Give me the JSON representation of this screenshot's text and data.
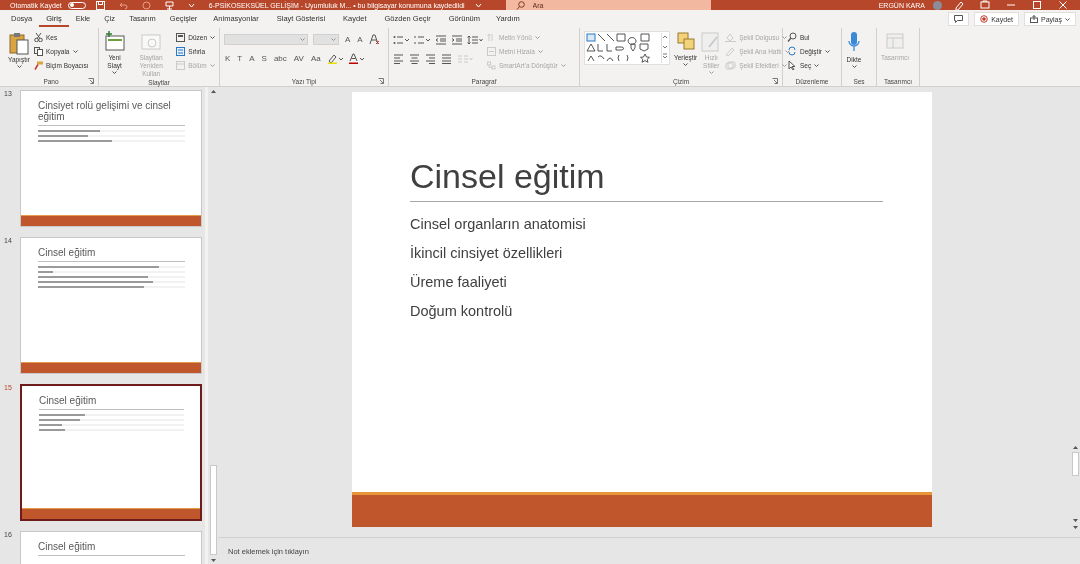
{
  "title_bar": {
    "autosave_label": "Otomatik Kaydet",
    "autosave_on": false,
    "document_title": "6-PSİKOSEKSÜEL GELİŞİM - Uyumluluk M... • bu bilgisayar konumuna kaydedildi",
    "search": {
      "placeholder": "Ara"
    },
    "user_name": "ERGÜN KARA"
  },
  "tabs": [
    {
      "label": "Dosya",
      "selected": false
    },
    {
      "label": "Giriş",
      "selected": true
    },
    {
      "label": "Ekle",
      "selected": false
    },
    {
      "label": "Çiz",
      "selected": false
    },
    {
      "label": "Tasarım",
      "selected": false
    },
    {
      "label": "Geçişler",
      "selected": false
    },
    {
      "label": "Animasyonlar",
      "selected": false
    },
    {
      "label": "Slayt Gösterisi",
      "selected": false
    },
    {
      "label": "Kaydet",
      "selected": false
    },
    {
      "label": "Gözden Geçir",
      "selected": false
    },
    {
      "label": "Görünüm",
      "selected": false
    },
    {
      "label": "Yardım",
      "selected": false
    }
  ],
  "actions": [
    {
      "kind": "comments"
    },
    {
      "kind": "record",
      "label": "Kaydet"
    },
    {
      "kind": "share",
      "label": "Paylaş"
    }
  ],
  "ribbon": [
    {
      "label": "Pano",
      "launcher": true,
      "columns": [
        [
          {
            "kind": "paste",
            "label": "Yapıştır",
            "disabled": false
          }
        ],
        [
          {
            "kind": "cut",
            "label": "Kes",
            "disabled": false
          },
          {
            "kind": "copy",
            "label": "Kopyala",
            "disabled": false
          },
          {
            "kind": "painter",
            "label": "Biçim Boyacısı",
            "disabled": false
          }
        ]
      ]
    },
    {
      "label": "Slaytlar",
      "launcher": false,
      "columns": [
        [
          {
            "kind": "newslide",
            "label": "Yeni Slayt",
            "disabled": false
          }
        ],
        [
          {
            "kind": "reuse",
            "label": "Slaytları Yeniden Kullan",
            "disabled": true
          }
        ],
        [
          {
            "kind": "layout",
            "label": "Düzen",
            "disabled": false
          },
          {
            "kind": "reset",
            "label": "Sıfırla",
            "disabled": false
          },
          {
            "kind": "section",
            "label": "Bölüm",
            "disabled": true
          }
        ]
      ]
    },
    {
      "label": "Yazı Tipi",
      "launcher": true,
      "columns": [
        [
          {
            "kind": "row",
            "items": [
              {
                "kind": "fontname",
                "disabled": true
              },
              {
                "kind": "fontsize",
                "disabled": true
              },
              {
                "kind": "glyph",
                "label": "A",
                "disabled": false
              },
              {
                "kind": "glyph",
                "label": "A",
                "disabled": false
              },
              {
                "kind": "clearformat",
                "disabled": false
              }
            ]
          },
          {
            "kind": "row",
            "items": [
              {
                "kind": "glyph",
                "label": "K",
                "disabled": false
              },
              {
                "kind": "glyph",
                "label": "T",
                "disabled": false
              },
              {
                "kind": "glyph",
                "label": "A",
                "disabled": false
              },
              {
                "kind": "glyph",
                "label": "S",
                "disabled": false
              },
              {
                "kind": "glyph",
                "label": "abc",
                "disabled": false
              },
              {
                "kind": "glyph",
                "label": "AV",
                "disabled": false
              },
              {
                "kind": "glyph",
                "label": "Aa",
                "disabled": false
              },
              {
                "kind": "highlight",
                "disabled": false
              },
              {
                "kind": "fontcolor",
                "disabled": false
              }
            ]
          }
        ]
      ]
    },
    {
      "label": "Paragraf",
      "launcher": false,
      "columns": [
        [
          {
            "kind": "row",
            "items": [
              {
                "kind": "bullets",
                "disabled": false
              },
              {
                "kind": "numbering",
                "disabled": false
              },
              {
                "kind": "outdent",
                "disabled": false
              },
              {
                "kind": "indent",
                "disabled": false
              },
              {
                "kind": "linespacing",
                "disabled": false
              }
            ]
          },
          {
            "kind": "row",
            "items": [
              {
                "kind": "alignleft",
                "disabled": false
              },
              {
                "kind": "aligncenter",
                "disabled": false
              },
              {
                "kind": "alignright",
                "disabled": false
              },
              {
                "kind": "justify",
                "disabled": false
              },
              {
                "kind": "textcolumns",
                "disabled": true
              }
            ]
          }
        ],
        [
          {
            "kind": "textdir",
            "label": "Metin Yönü",
            "disabled": true
          },
          {
            "kind": "textalign",
            "label": "Metni Hizala",
            "disabled": true
          },
          {
            "kind": "smartart",
            "label": "SmartArt'a Dönüştür",
            "disabled": true
          }
        ]
      ]
    },
    {
      "label": "Çizim",
      "launcher": true,
      "columns": [
        [
          {
            "kind": "shapes",
            "disabled": false
          }
        ],
        [
          {
            "kind": "arrange",
            "label": "Yerleştir",
            "disabled": false
          }
        ],
        [
          {
            "kind": "quickstyles",
            "label": "Hızlı Stiller",
            "disabled": true
          }
        ],
        [
          {
            "kind": "fill",
            "label": "Şekil Dolgusu",
            "disabled": true
          },
          {
            "kind": "outline",
            "label": "Şekil Ana Hattı",
            "disabled": true
          },
          {
            "kind": "effects",
            "label": "Şekil Efektleri",
            "disabled": true
          }
        ]
      ]
    },
    {
      "label": "Düzenleme",
      "launcher": false,
      "columns": [
        [
          {
            "kind": "find",
            "label": "Bul",
            "disabled": false
          },
          {
            "kind": "replace",
            "label": "Değiştir",
            "disabled": false
          },
          {
            "kind": "select",
            "label": "Seç",
            "disabled": false
          }
        ]
      ]
    },
    {
      "label": "Ses",
      "launcher": false,
      "columns": [
        [
          {
            "kind": "dictate",
            "label": "Dikte",
            "disabled": false
          }
        ]
      ]
    },
    {
      "label": "Tasarımcı",
      "launcher": false,
      "columns": [
        [
          {
            "kind": "designer",
            "label": "Tasarımcı",
            "disabled": true
          }
        ]
      ]
    }
  ],
  "thumbnails": [
    {
      "number": "13",
      "title": "Cinsiyet rolü gelişimi ve cinsel eğitim",
      "selected": false,
      "text_lines": [
        {
          "level": 0.42
        },
        {
          "level": 0.34
        },
        {
          "level": 0.5
        }
      ]
    },
    {
      "number": "14",
      "title": "Cinsel eğitim",
      "selected": false,
      "text_lines": [
        {
          "level": 0.82
        },
        {
          "level": 0.1
        },
        {
          "level": 0.75
        },
        {
          "level": 0.78
        },
        {
          "level": 0.72
        }
      ]
    },
    {
      "number": "15",
      "title": "Cinsel eğitim",
      "selected": true,
      "text_lines": [
        {
          "level": 0.32
        },
        {
          "level": 0.28
        },
        {
          "level": 0.16
        },
        {
          "level": 0.18
        }
      ]
    },
    {
      "number": "16",
      "title": "Cinsel eğitim",
      "selected": false
    }
  ],
  "slide": {
    "title": "Cinsel eğitim",
    "bullets": [
      "Cinsel organların anatomisi",
      "İkincil cinsiyet özellikleri",
      "Üreme faaliyeti",
      "Doğum kontrolü"
    ]
  },
  "notes": {
    "placeholder": "Not eklemek için tıklayın"
  }
}
